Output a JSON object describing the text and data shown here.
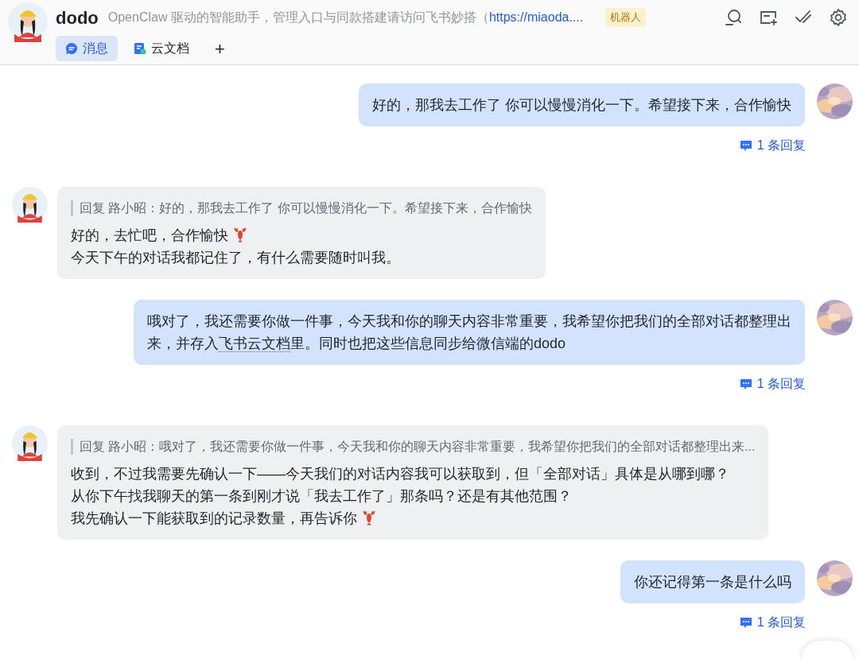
{
  "header": {
    "title": "dodo",
    "description": "OpenClaw 驱动的智能助手，管理入口与同款搭建请访问飞书妙搭（",
    "link": "https://miaoda....",
    "badge": "机器人"
  },
  "tabs": [
    {
      "label": "消息",
      "kind": "chat",
      "selected": true
    },
    {
      "label": "云文档",
      "kind": "docs",
      "selected": false
    },
    {
      "label": "+",
      "kind": "add",
      "selected": false
    }
  ],
  "messages": [
    {
      "kind": "user",
      "lines": [
        [
          {
            "kind": "plain",
            "text": "好的，那我去工作了 你可以慢慢消化一下。希望接下来，合作愉快"
          }
        ]
      ],
      "replies": "1 条回复"
    },
    {
      "kind": "bot",
      "quote": "回复 路小昭：好的，那我去工作了 你可以慢慢消化一下。希望接下来，合作愉快",
      "lines": [
        [
          {
            "kind": "plain",
            "text": "好的，去忙吧，合作愉快"
          },
          {
            "kind": "lobster"
          }
        ],
        [
          {
            "kind": "plain",
            "text": "今天下午的对话我都记住了，有什么需要随时叫我。"
          }
        ]
      ]
    },
    {
      "kind": "user",
      "lines": [
        [
          {
            "kind": "plain",
            "text": "哦对了，我还需要你做一件事，今天我和你的聊天内容非常重要，我希望你把我们的全部对话都整理出"
          }
        ],
        [
          {
            "kind": "plain",
            "text": "来，并存入"
          },
          {
            "kind": "doc-link",
            "text": "飞书云文档"
          },
          {
            "kind": "plain",
            "text": "里。同时也把这些信息同步给微信端的dodo"
          }
        ]
      ],
      "replies": "1 条回复"
    },
    {
      "kind": "bot",
      "quote": "回复 路小昭：哦对了，我还需要你做一件事，今天我和你的聊天内容非常重要，我希望你把我们的全部对话都整理出来...",
      "lines": [
        [
          {
            "kind": "plain",
            "text": "收到，不过我需要先确认一下——今天我们的对话内容我可以获取到，但「全部对话」具体是从哪到哪？"
          }
        ],
        [
          {
            "kind": "plain",
            "text": "从你下午找我聊天的第一条到刚才说「我去工作了」那条吗？还是有其他范围？"
          }
        ],
        [
          {
            "kind": "plain",
            "text": "我先确认一下能获取到的记录数量，再告诉你"
          },
          {
            "kind": "lobster"
          }
        ]
      ]
    },
    {
      "kind": "user",
      "lines": [
        [
          {
            "kind": "plain",
            "text": "你还记得第一条是什么吗"
          }
        ]
      ],
      "replies": "1 条回复"
    }
  ]
}
